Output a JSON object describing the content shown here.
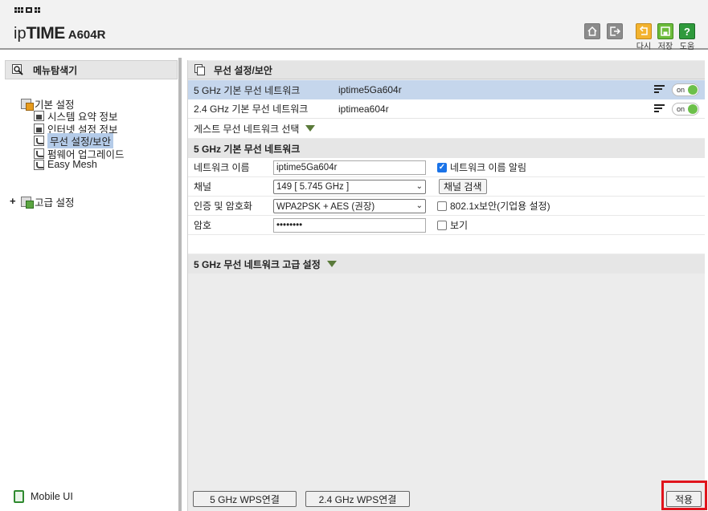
{
  "header": {
    "brand_prefix": "ip",
    "brand_main": "TIME",
    "model": "A604R",
    "buttons": [
      {
        "icon": "home-icon",
        "label": ""
      },
      {
        "icon": "logout-icon",
        "label": ""
      },
      {
        "icon": "undo-icon",
        "label": "다시"
      },
      {
        "icon": "save-icon",
        "label": "저장"
      },
      {
        "icon": "help-icon",
        "glyph": "?",
        "label": "도움"
      }
    ],
    "colors": {
      "undo": "#f3b32f",
      "save": "#6dbc3b",
      "help": "#2f9a3c"
    }
  },
  "sidebar": {
    "title": "메뉴탐색기",
    "basic": {
      "label": "기본 설정",
      "items": [
        {
          "label": "시스템 요약 정보",
          "icon": "chart-icon"
        },
        {
          "label": "인터넷 설정 정보",
          "icon": "monitor-icon"
        },
        {
          "label": "무선 설정/보안",
          "icon": "wireless-icon",
          "selected": true
        },
        {
          "label": "펌웨어 업그레이드",
          "icon": "upgrade-icon"
        },
        {
          "label": "Easy Mesh",
          "icon": "mesh-icon"
        }
      ]
    },
    "advanced": {
      "expander": "+",
      "label": "고급 설정"
    },
    "mobile": "Mobile UI"
  },
  "main": {
    "title": "무선 설정/보안",
    "networks": [
      {
        "band": "5 GHz 기본 무선 네트워크",
        "ssid": "iptime5Ga604r",
        "toggle": "on",
        "active": true
      },
      {
        "band": "2.4 GHz 기본 무선 네트워크",
        "ssid": "iptimea604r",
        "toggle": "on",
        "active": false
      }
    ],
    "guest": "게스트 무선 네트워크 선택",
    "section": "5 GHz 기본 무선 네트워크",
    "form": {
      "network_name_label": "네트워크 이름",
      "network_name_value": "iptime5Ga604r",
      "broadcast_label": "네트워크 이름 알림",
      "channel_label": "채널",
      "channel_value": "149 [ 5.745 GHz ]",
      "channel_scan": "채널 검색",
      "auth_label": "인증 및 암호화",
      "auth_value": "WPA2PSK + AES (권장)",
      "enterprise_label": "802.1x보안(기업용 설정)",
      "password_label": "암호",
      "password_value": "••••••••",
      "show_label": "보기"
    },
    "advanced_section": "5 GHz 무선 네트워크 고급 설정",
    "wps_5g": "5 GHz WPS연결",
    "wps_24g": "2.4 GHz WPS연결",
    "apply": "적용"
  }
}
